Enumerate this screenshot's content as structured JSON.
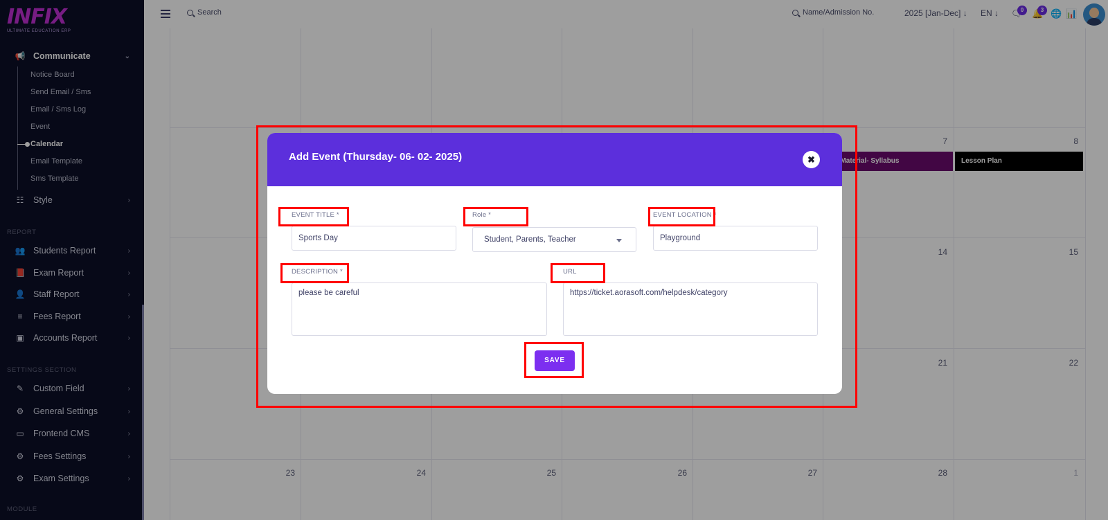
{
  "sidebar": {
    "logo_text": "INFIX",
    "logo_tagline": "ULTIMATE EDUCATION ERP",
    "communicate": {
      "label": "Communicate",
      "icon": "megaphone-icon"
    },
    "sub_items": [
      "Notice Board",
      "Send Email / Sms",
      "Email / Sms Log",
      "Event",
      "Calendar",
      "Email Template",
      "Sms Template"
    ],
    "active_sub_item": "Calendar",
    "style_label": "Style",
    "report_section": "REPORT",
    "report_items": [
      "Students Report",
      "Exam Report",
      "Staff Report",
      "Fees Report",
      "Accounts Report"
    ],
    "settings_section": "SETTINGS SECTION",
    "settings_items": [
      "Custom Field",
      "General Settings",
      "Frontend CMS",
      "Fees Settings",
      "Exam Settings"
    ],
    "module_section": "MODULE"
  },
  "topbar": {
    "search_label": "Search",
    "admission_search": "Name/Admission No.",
    "year": "2025 [Jan-Dec]",
    "language": "EN",
    "chat_badge": "0",
    "notification_badge": "3"
  },
  "calendar": {
    "week2_days": [
      "7",
      "8"
    ],
    "week3_days": [
      "14",
      "15"
    ],
    "week4_days": [
      "21",
      "22"
    ],
    "week5_days": [
      "23",
      "24",
      "25",
      "26",
      "27",
      "28",
      "1"
    ],
    "events": [
      {
        "label": "dy Material- Syllabus",
        "color": "#6b0a6e"
      },
      {
        "label": "Lesson Plan",
        "color": "#000000"
      }
    ]
  },
  "modal": {
    "title": "Add Event (Thursday- 06- 02- 2025)",
    "event_title_label": "EVENT TITLE *",
    "event_title_value": "Sports Day",
    "role_label": "Role *",
    "role_value": "Student, Parents, Teacher",
    "location_label": "EVENT LOCATION *",
    "location_value": "Playground",
    "description_label": "DESCRIPTION *",
    "description_value": "please be careful",
    "url_label": "URL",
    "url_value": "https://ticket.aorasoft.com/helpdesk/category",
    "save_label": "SAVE",
    "header_color": "#5c2fdc",
    "save_color": "#7c2ff0"
  },
  "annotation_color": "#ff0000"
}
